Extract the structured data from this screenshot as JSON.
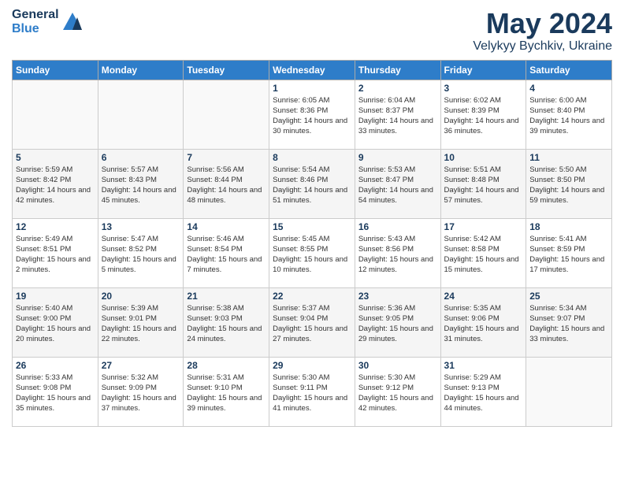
{
  "header": {
    "logo": {
      "general": "General",
      "blue": "Blue"
    },
    "title": "May 2024",
    "location": "Velykyy Bychkiv, Ukraine"
  },
  "weekdays": [
    "Sunday",
    "Monday",
    "Tuesday",
    "Wednesday",
    "Thursday",
    "Friday",
    "Saturday"
  ],
  "weeks": [
    [
      {
        "day": "",
        "sunrise": "",
        "sunset": "",
        "daylight": ""
      },
      {
        "day": "",
        "sunrise": "",
        "sunset": "",
        "daylight": ""
      },
      {
        "day": "",
        "sunrise": "",
        "sunset": "",
        "daylight": ""
      },
      {
        "day": "1",
        "sunrise": "Sunrise: 6:05 AM",
        "sunset": "Sunset: 8:36 PM",
        "daylight": "Daylight: 14 hours and 30 minutes."
      },
      {
        "day": "2",
        "sunrise": "Sunrise: 6:04 AM",
        "sunset": "Sunset: 8:37 PM",
        "daylight": "Daylight: 14 hours and 33 minutes."
      },
      {
        "day": "3",
        "sunrise": "Sunrise: 6:02 AM",
        "sunset": "Sunset: 8:39 PM",
        "daylight": "Daylight: 14 hours and 36 minutes."
      },
      {
        "day": "4",
        "sunrise": "Sunrise: 6:00 AM",
        "sunset": "Sunset: 8:40 PM",
        "daylight": "Daylight: 14 hours and 39 minutes."
      }
    ],
    [
      {
        "day": "5",
        "sunrise": "Sunrise: 5:59 AM",
        "sunset": "Sunset: 8:42 PM",
        "daylight": "Daylight: 14 hours and 42 minutes."
      },
      {
        "day": "6",
        "sunrise": "Sunrise: 5:57 AM",
        "sunset": "Sunset: 8:43 PM",
        "daylight": "Daylight: 14 hours and 45 minutes."
      },
      {
        "day": "7",
        "sunrise": "Sunrise: 5:56 AM",
        "sunset": "Sunset: 8:44 PM",
        "daylight": "Daylight: 14 hours and 48 minutes."
      },
      {
        "day": "8",
        "sunrise": "Sunrise: 5:54 AM",
        "sunset": "Sunset: 8:46 PM",
        "daylight": "Daylight: 14 hours and 51 minutes."
      },
      {
        "day": "9",
        "sunrise": "Sunrise: 5:53 AM",
        "sunset": "Sunset: 8:47 PM",
        "daylight": "Daylight: 14 hours and 54 minutes."
      },
      {
        "day": "10",
        "sunrise": "Sunrise: 5:51 AM",
        "sunset": "Sunset: 8:48 PM",
        "daylight": "Daylight: 14 hours and 57 minutes."
      },
      {
        "day": "11",
        "sunrise": "Sunrise: 5:50 AM",
        "sunset": "Sunset: 8:50 PM",
        "daylight": "Daylight: 14 hours and 59 minutes."
      }
    ],
    [
      {
        "day": "12",
        "sunrise": "Sunrise: 5:49 AM",
        "sunset": "Sunset: 8:51 PM",
        "daylight": "Daylight: 15 hours and 2 minutes."
      },
      {
        "day": "13",
        "sunrise": "Sunrise: 5:47 AM",
        "sunset": "Sunset: 8:52 PM",
        "daylight": "Daylight: 15 hours and 5 minutes."
      },
      {
        "day": "14",
        "sunrise": "Sunrise: 5:46 AM",
        "sunset": "Sunset: 8:54 PM",
        "daylight": "Daylight: 15 hours and 7 minutes."
      },
      {
        "day": "15",
        "sunrise": "Sunrise: 5:45 AM",
        "sunset": "Sunset: 8:55 PM",
        "daylight": "Daylight: 15 hours and 10 minutes."
      },
      {
        "day": "16",
        "sunrise": "Sunrise: 5:43 AM",
        "sunset": "Sunset: 8:56 PM",
        "daylight": "Daylight: 15 hours and 12 minutes."
      },
      {
        "day": "17",
        "sunrise": "Sunrise: 5:42 AM",
        "sunset": "Sunset: 8:58 PM",
        "daylight": "Daylight: 15 hours and 15 minutes."
      },
      {
        "day": "18",
        "sunrise": "Sunrise: 5:41 AM",
        "sunset": "Sunset: 8:59 PM",
        "daylight": "Daylight: 15 hours and 17 minutes."
      }
    ],
    [
      {
        "day": "19",
        "sunrise": "Sunrise: 5:40 AM",
        "sunset": "Sunset: 9:00 PM",
        "daylight": "Daylight: 15 hours and 20 minutes."
      },
      {
        "day": "20",
        "sunrise": "Sunrise: 5:39 AM",
        "sunset": "Sunset: 9:01 PM",
        "daylight": "Daylight: 15 hours and 22 minutes."
      },
      {
        "day": "21",
        "sunrise": "Sunrise: 5:38 AM",
        "sunset": "Sunset: 9:03 PM",
        "daylight": "Daylight: 15 hours and 24 minutes."
      },
      {
        "day": "22",
        "sunrise": "Sunrise: 5:37 AM",
        "sunset": "Sunset: 9:04 PM",
        "daylight": "Daylight: 15 hours and 27 minutes."
      },
      {
        "day": "23",
        "sunrise": "Sunrise: 5:36 AM",
        "sunset": "Sunset: 9:05 PM",
        "daylight": "Daylight: 15 hours and 29 minutes."
      },
      {
        "day": "24",
        "sunrise": "Sunrise: 5:35 AM",
        "sunset": "Sunset: 9:06 PM",
        "daylight": "Daylight: 15 hours and 31 minutes."
      },
      {
        "day": "25",
        "sunrise": "Sunrise: 5:34 AM",
        "sunset": "Sunset: 9:07 PM",
        "daylight": "Daylight: 15 hours and 33 minutes."
      }
    ],
    [
      {
        "day": "26",
        "sunrise": "Sunrise: 5:33 AM",
        "sunset": "Sunset: 9:08 PM",
        "daylight": "Daylight: 15 hours and 35 minutes."
      },
      {
        "day": "27",
        "sunrise": "Sunrise: 5:32 AM",
        "sunset": "Sunset: 9:09 PM",
        "daylight": "Daylight: 15 hours and 37 minutes."
      },
      {
        "day": "28",
        "sunrise": "Sunrise: 5:31 AM",
        "sunset": "Sunset: 9:10 PM",
        "daylight": "Daylight: 15 hours and 39 minutes."
      },
      {
        "day": "29",
        "sunrise": "Sunrise: 5:30 AM",
        "sunset": "Sunset: 9:11 PM",
        "daylight": "Daylight: 15 hours and 41 minutes."
      },
      {
        "day": "30",
        "sunrise": "Sunrise: 5:30 AM",
        "sunset": "Sunset: 9:12 PM",
        "daylight": "Daylight: 15 hours and 42 minutes."
      },
      {
        "day": "31",
        "sunrise": "Sunrise: 5:29 AM",
        "sunset": "Sunset: 9:13 PM",
        "daylight": "Daylight: 15 hours and 44 minutes."
      },
      {
        "day": "",
        "sunrise": "",
        "sunset": "",
        "daylight": ""
      }
    ]
  ]
}
